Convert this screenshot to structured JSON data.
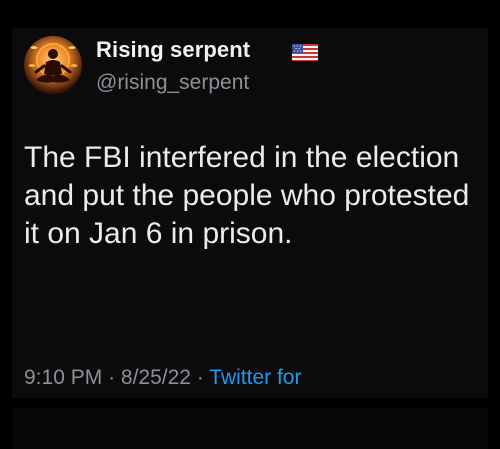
{
  "tweet": {
    "author": {
      "display_name": "Rising serpent",
      "handle": "@rising_serpent",
      "avatar_icon": "meditating-figure-avatar",
      "badge_icon": "us-flag-icon"
    },
    "text": "The FBI interfered in the election and put the people who protested it on Jan 6 in prison.",
    "time": "9:10 PM",
    "separator": "·",
    "date": "8/25/22",
    "source": "Twitter for"
  },
  "colors": {
    "background": "#0b0b0c",
    "text": "#ececec",
    "secondary": "#8b9198",
    "link": "#1d9bf0"
  }
}
